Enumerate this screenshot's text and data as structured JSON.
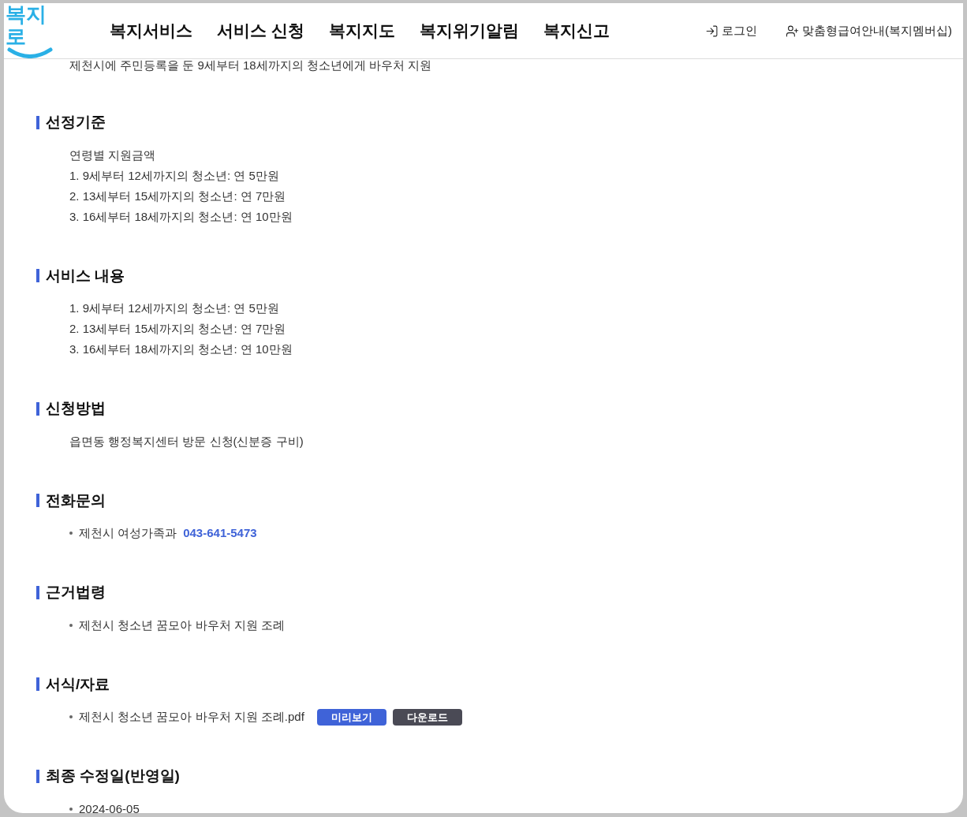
{
  "header": {
    "logo": "복지로",
    "nav": [
      {
        "label": "복지서비스"
      },
      {
        "label": "서비스 신청"
      },
      {
        "label": "복지지도"
      },
      {
        "label": "복지위기알림"
      },
      {
        "label": "복지신고"
      }
    ],
    "login": "로그인",
    "membership": "맞춤형급여안내(복지멤버십)"
  },
  "intro": "제천시에 주민등록을 둔 9세부터 18세까지의 청소년에게 바우처 지원",
  "sections": [
    {
      "title": "선정기준",
      "items": [
        {
          "kind": "line",
          "text": "연령별 지원금액"
        },
        {
          "kind": "line",
          "text": "1. 9세부터 12세까지의 청소년: 연 5만원"
        },
        {
          "kind": "line",
          "text": "2. 13세부터 15세까지의 청소년: 연 7만원"
        },
        {
          "kind": "line",
          "text": "3. 16세부터 18세까지의 청소년: 연 10만원"
        }
      ]
    },
    {
      "title": "서비스 내용",
      "items": [
        {
          "kind": "line",
          "text": "1. 9세부터 12세까지의 청소년: 연 5만원"
        },
        {
          "kind": "line",
          "text": "2. 13세부터 15세까지의 청소년: 연 7만원"
        },
        {
          "kind": "line",
          "text": "3. 16세부터 18세까지의 청소년: 연 10만원"
        }
      ]
    },
    {
      "title": "신청방법",
      "items": [
        {
          "kind": "line",
          "text": "읍면동 행정복지센터 방문 신청(신분증 구비)"
        }
      ]
    },
    {
      "title": "전화문의",
      "items": [
        {
          "kind": "bullet",
          "text": "제천시 여성가족과",
          "phone": "043-641-5473"
        }
      ]
    },
    {
      "title": "근거법령",
      "items": [
        {
          "kind": "bullet",
          "text": "제천시 청소년 꿈모아 바우처 지원 조례"
        }
      ]
    },
    {
      "title": "서식/자료",
      "items": [
        {
          "kind": "bullet",
          "text": "제천시 청소년 꿈모아 바우처 지원 조례.pdf",
          "buttons": [
            {
              "label": "미리보기",
              "kind": "preview"
            },
            {
              "label": "다운로드",
              "kind": "download"
            }
          ]
        }
      ]
    },
    {
      "title": "최종 수정일(반영일)",
      "items": [
        {
          "kind": "bullet",
          "text": "2024-06-05"
        }
      ]
    }
  ]
}
